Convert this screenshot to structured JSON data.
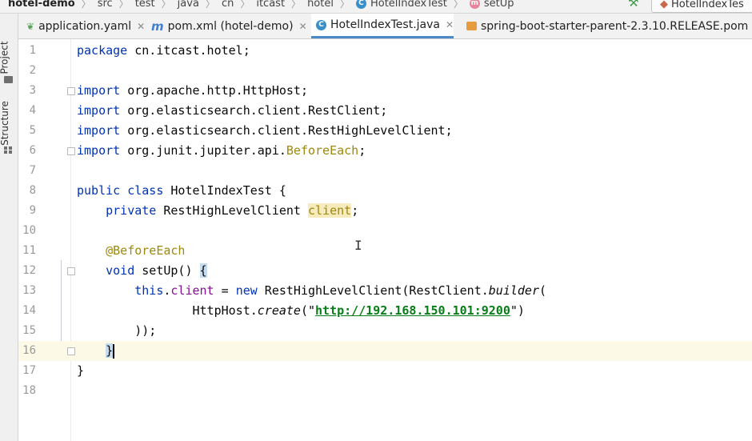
{
  "breadcrumbs": {
    "items": [
      "hotel-demo",
      "src",
      "test",
      "java",
      "cn",
      "itcast",
      "hotel",
      "HotelIndexTest",
      "setUp"
    ],
    "class_icon_letter": "C",
    "method_icon_letter": "m"
  },
  "run_config": {
    "label": "HotelIndexTes"
  },
  "tool_window_stripe": {
    "project_label": "Project",
    "structure_label": "Structure"
  },
  "tabs": [
    {
      "label": "application.yaml",
      "icon": "yaml-icon",
      "active": false
    },
    {
      "label": "pom.xml (hotel-demo)",
      "icon": "maven-m-icon",
      "active": false
    },
    {
      "label": "HotelIndexTest.java",
      "icon": "java-class-icon",
      "active": true
    },
    {
      "label": "spring-boot-starter-parent-2.3.10.RELEASE.pom",
      "icon": "pom-icon",
      "active": false
    }
  ],
  "tab_icon_letters": {
    "pom": "m",
    "java": "C"
  },
  "editor": {
    "current_line": 16,
    "line_numbers": [
      "1",
      "2",
      "3",
      "4",
      "5",
      "6",
      "7",
      "8",
      "9",
      "10",
      "11",
      "12",
      "13",
      "14",
      "15",
      "16",
      "17",
      "18"
    ],
    "lines": {
      "l1": {
        "kw": "package",
        "rest": " cn.itcast.hotel;"
      },
      "l3": {
        "kw": "import",
        "rest": " org.apache.http.HttpHost;"
      },
      "l4": {
        "kw": "import",
        "rest": " org.elasticsearch.client.RestClient;"
      },
      "l5": {
        "kw": "import",
        "rest": " org.elasticsearch.client.RestHighLevelClient;"
      },
      "l6": {
        "kw": "import",
        "rest": " org.junit.jupiter.api.",
        "ann": "BeforeEach",
        "end": ";"
      },
      "l8": {
        "kw": "public class",
        "rest": " HotelIndexTest {"
      },
      "l9": {
        "indent": "    ",
        "kw": "private",
        "rest": " RestHighLevelClient ",
        "field": "client",
        "end": ";"
      },
      "l11": {
        "indent": "    ",
        "ann": "@BeforeEach"
      },
      "l12": {
        "indent": "    ",
        "kw": "void",
        "rest": " setUp() ",
        "brace": "{"
      },
      "l13": {
        "indent": "        ",
        "kw1": "this",
        "dot": ".",
        "field": "client",
        "mid": " = ",
        "kw2": "new",
        "rest": " RestHighLevelClient(RestClient.",
        "static": "builder",
        "end": "("
      },
      "l14": {
        "indent": "                ",
        "pre": "HttpHost.",
        "static": "create",
        "open": "(\"",
        "str": "http://192.168.150.101:9200",
        "close": "\")"
      },
      "l15": {
        "indent": "        ",
        "rest": "));"
      },
      "l16": {
        "indent": "    ",
        "brace": "}"
      },
      "l17": {
        "rest": "}"
      }
    }
  }
}
